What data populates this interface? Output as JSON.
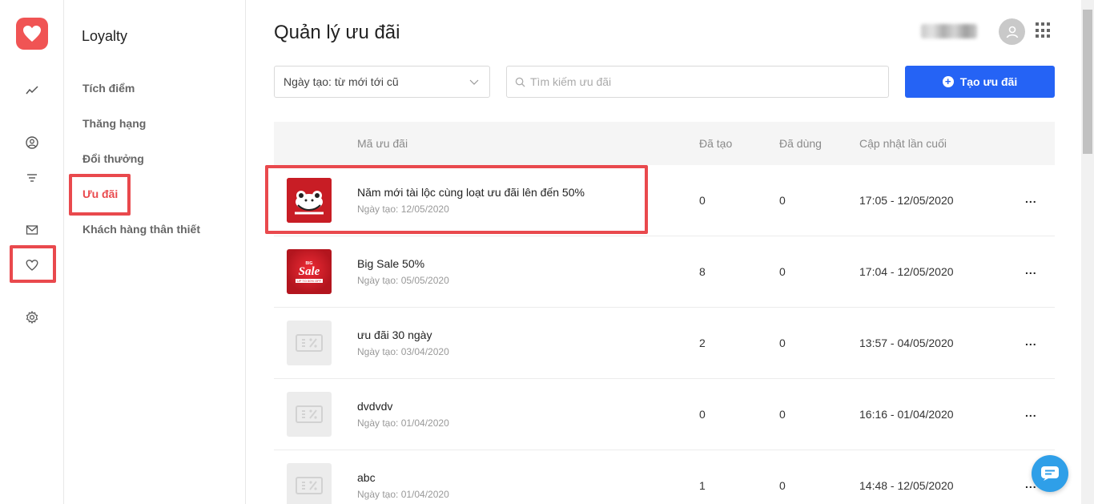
{
  "app": {
    "brand_color": "#f05454",
    "accent_color": "#2563f5",
    "highlight_color": "#e9494d"
  },
  "rail": {
    "items": [
      {
        "icon": "trend-icon"
      },
      {
        "icon": "user-circle-icon"
      },
      {
        "icon": "filter-icon"
      },
      {
        "icon": "mail-icon"
      },
      {
        "icon": "heart-icon",
        "active": true
      },
      {
        "icon": "gear-icon"
      }
    ]
  },
  "subnav": {
    "title": "Loyalty",
    "items": [
      {
        "label": "Tích điểm"
      },
      {
        "label": "Thăng hạng"
      },
      {
        "label": "Đổi thưởng"
      },
      {
        "label": "Ưu đãi",
        "active": true
      },
      {
        "label": "Khách hàng thân thiết"
      }
    ]
  },
  "main": {
    "title": "Quản lý ưu đãi",
    "sort_value": "Ngày tạo: từ mới tới cũ",
    "search_placeholder": "Tìm kiếm ưu đãi",
    "create_label": "Tạo ưu đãi"
  },
  "table": {
    "headers": [
      "Mã ưu đãi",
      "Đã tạo",
      "Đã dùng",
      "Cập nhật lần cuối"
    ],
    "rows": [
      {
        "name": "Năm mới tài lộc cùng loạt ưu đãi lên đến 50%",
        "created": "Ngày tạo: 12/05/2020",
        "made": "0",
        "used": "0",
        "updated": "17:05 - 12/05/2020",
        "thumb": "lunar"
      },
      {
        "name": "Big Sale 50%",
        "created": "Ngày tạo: 05/05/2020",
        "made": "8",
        "used": "0",
        "updated": "17:04 - 12/05/2020",
        "thumb": "sale"
      },
      {
        "name": "ưu đãi 30 ngày",
        "created": "Ngày tạo: 03/04/2020",
        "made": "2",
        "used": "0",
        "updated": "13:57 - 04/05/2020",
        "thumb": "placeholder"
      },
      {
        "name": "dvdvdv",
        "created": "Ngày tạo: 01/04/2020",
        "made": "0",
        "used": "0",
        "updated": "16:16 - 01/04/2020",
        "thumb": "placeholder"
      },
      {
        "name": "abc",
        "created": "Ngày tạo: 01/04/2020",
        "made": "1",
        "used": "0",
        "updated": "14:48 - 12/05/2020",
        "thumb": "placeholder"
      }
    ],
    "more_label": "..."
  },
  "sale_thumb_text": {
    "top": "BIG",
    "main": "Sale",
    "sub": "UP TO 50% OFF"
  }
}
